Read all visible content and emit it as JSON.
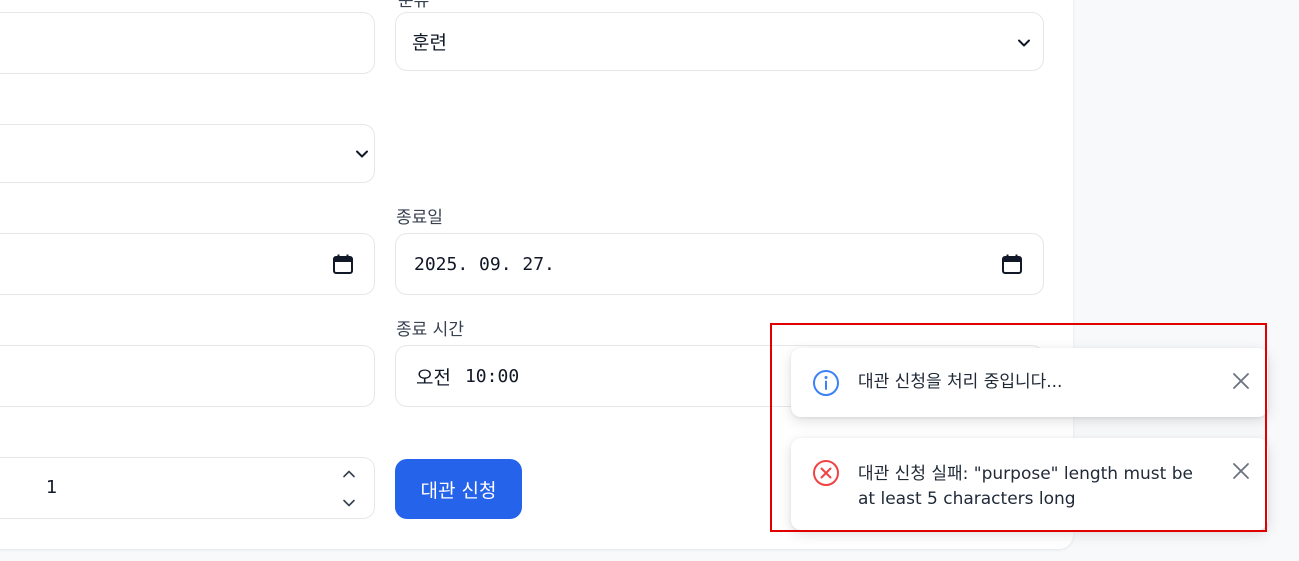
{
  "form": {
    "category_label": "분류",
    "category_value": "훈련",
    "end_date_label": "종료일",
    "end_date_value": "2025. 09. 27.",
    "end_time_label": "종료 시간",
    "end_time_period": "오전",
    "end_time_value": "10:00",
    "quantity_value": "1",
    "submit_label": "대관 신청"
  },
  "toasts": [
    {
      "type": "info",
      "icon": "info-icon",
      "message": "대관 신청을 처리 중입니다...",
      "color": "#3b82f6"
    },
    {
      "type": "error",
      "icon": "error-x-icon",
      "message_line1": "대관 신청 실패: \"purpose\" length must be",
      "message_line2": "at least 5 characters long",
      "color": "#ef4444"
    }
  ],
  "colors": {
    "primary": "#2563eb",
    "highlight": "#e00000"
  }
}
